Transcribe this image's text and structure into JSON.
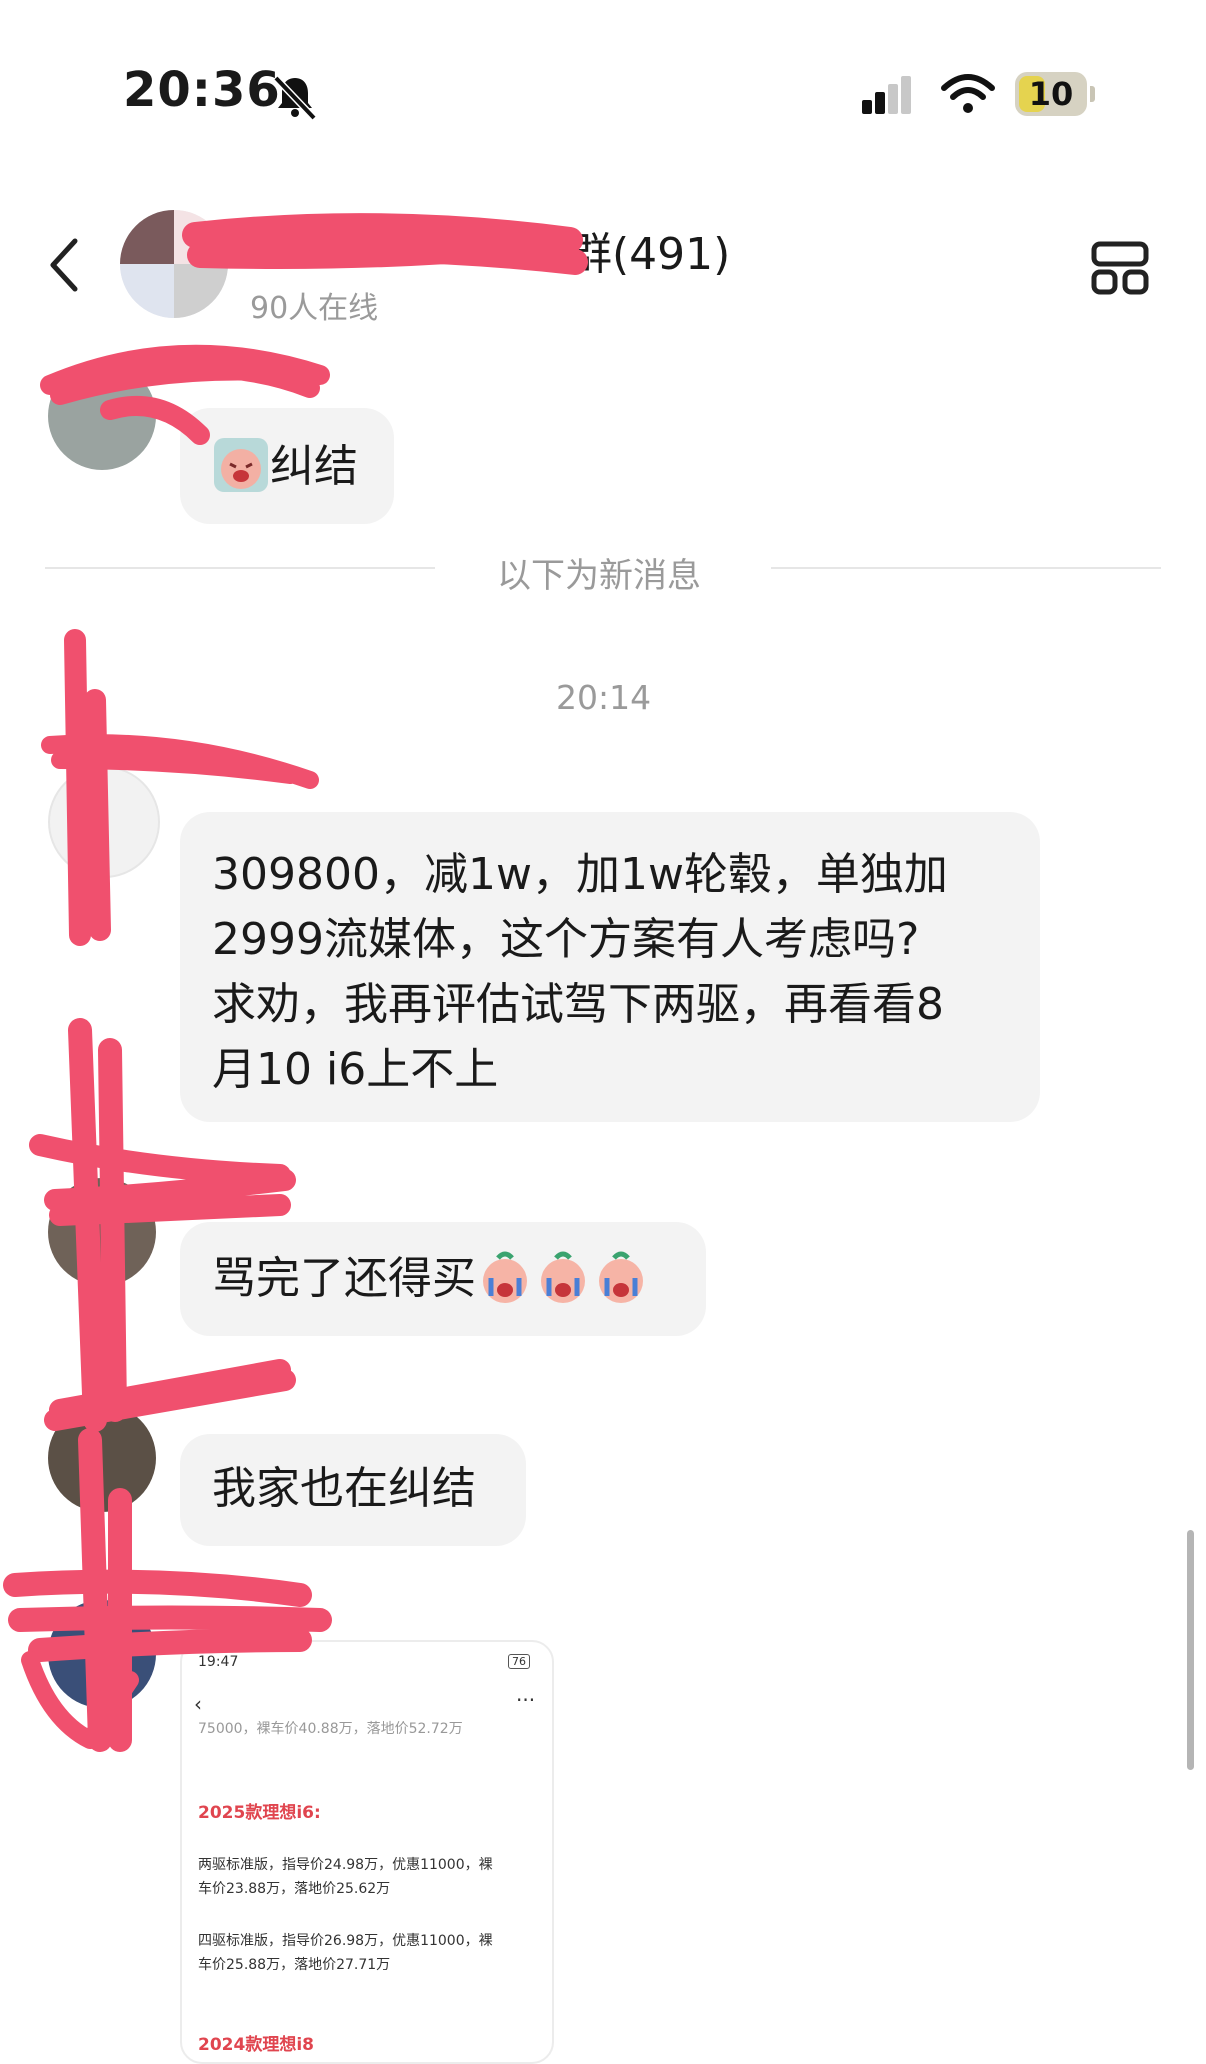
{
  "status_bar": {
    "time": "20:36",
    "battery": "10",
    "icons": [
      "bell-slash-icon",
      "cellular-signal-icon",
      "wifi-icon",
      "battery-icon"
    ]
  },
  "header": {
    "title_suffix": "1群(491)",
    "online": "90人在线",
    "back_icon": "chevron-left-icon",
    "more_icon": "grid-layout-icon"
  },
  "messages": {
    "m0": {
      "text": "纠结",
      "emoji": "crying-peach-emoji"
    },
    "divider": "以下为新消息",
    "timestamp": "20:14",
    "m1": {
      "lines": [
        "309800，减1w，加1w轮毂，单独加",
        "2999流媒体，这个方案有人考虑吗?",
        "求劝，我再评估试驾下两驱，再看看8",
        "月10 i6上不上"
      ]
    },
    "m2": {
      "text": "骂完了还得买",
      "emoji": "crying-peach-emoji"
    },
    "m3": {
      "text": "我家也在纠结"
    },
    "m4": {
      "image": {
        "status": "19:47",
        "battery": "76",
        "cut_line": "75000，裸车价40.88万，落地价52.72万",
        "heading": "2025款理想i6:",
        "p1_l1": "两驱标准版，指导价24.98万，优惠11000，裸",
        "p1_l2": "车价23.88万，落地价25.62万",
        "p2_l1": "四驱标准版，指导价26.98万，优惠11000，裸",
        "p2_l2": "车价25.88万，落地价27.71万",
        "footer_heading": "2024款理想i8"
      }
    }
  },
  "colors": {
    "bubble": "#f3f3f3",
    "scribble": "#f0506e",
    "heading_red": "#e0454f"
  }
}
